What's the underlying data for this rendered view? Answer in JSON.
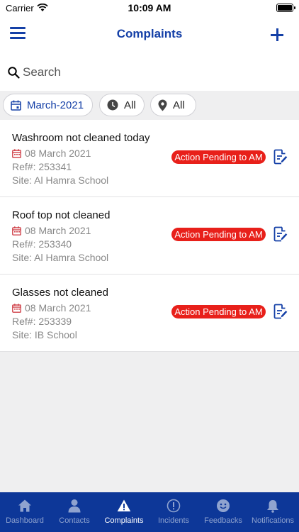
{
  "status_bar": {
    "carrier": "Carrier",
    "time": "10:09 AM"
  },
  "nav": {
    "title": "Complaints",
    "menu_icon": "hamburger-menu-icon",
    "add_icon": "plus-icon"
  },
  "search": {
    "placeholder": "Search",
    "value": ""
  },
  "filters": {
    "date": "March-2021",
    "time": "All",
    "site": "All"
  },
  "complaints": [
    {
      "title": "Washroom not cleaned today",
      "date": "08 March 2021",
      "ref": "Ref#: 253341",
      "site": "Site: Al Hamra School",
      "status": "Action Pending to AM"
    },
    {
      "title": "Roof top not cleaned",
      "date": "08 March 2021",
      "ref": "Ref#: 253340",
      "site": "Site: Al Hamra School",
      "status": "Action Pending to AM"
    },
    {
      "title": "Glasses not cleaned",
      "date": "08 March 2021",
      "ref": "Ref#: 253339",
      "site": "Site: IB School",
      "status": "Action Pending to AM"
    }
  ],
  "tabs": [
    {
      "label": "Dashboard",
      "icon": "home-icon",
      "active": false
    },
    {
      "label": "Contacts",
      "icon": "person-icon",
      "active": false
    },
    {
      "label": "Complaints",
      "icon": "warning-icon",
      "active": true
    },
    {
      "label": "Incidents",
      "icon": "alert-circle-icon",
      "active": false
    },
    {
      "label": "Feedbacks",
      "icon": "smiley-icon",
      "active": false
    },
    {
      "label": "Notifications",
      "icon": "bell-icon",
      "active": false
    }
  ],
  "colors": {
    "brand": "#1540a7",
    "tab_bar": "#0d3798",
    "status_badge": "#e8201a",
    "calendar": "#d0424a"
  }
}
